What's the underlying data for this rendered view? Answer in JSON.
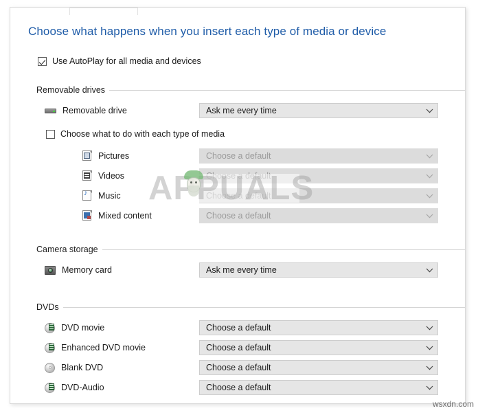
{
  "window": {
    "page_title": "Choose what happens when you insert each type of media or device"
  },
  "autoplay_toggle": {
    "label": "Use AutoPlay for all media and devices",
    "checked": true
  },
  "each_type_toggle": {
    "label": "Choose what to do with each type of media",
    "checked": false
  },
  "sections": {
    "removable_drives": {
      "label": "Removable drives",
      "rows": [
        {
          "icon": "removable-drive-icon",
          "label": "Removable drive",
          "value": "Ask me every time",
          "enabled": true
        }
      ],
      "media_types": [
        {
          "icon": "pictures-icon",
          "label": "Pictures",
          "value": "Choose a default",
          "enabled": false
        },
        {
          "icon": "videos-icon",
          "label": "Videos",
          "value": "Choose a default",
          "enabled": false
        },
        {
          "icon": "music-icon",
          "label": "Music",
          "value": "Choose a default",
          "enabled": false
        },
        {
          "icon": "mixed-content-icon",
          "label": "Mixed content",
          "value": "Choose a default",
          "enabled": false
        }
      ]
    },
    "camera_storage": {
      "label": "Camera storage",
      "rows": [
        {
          "icon": "memory-card-icon",
          "label": "Memory card",
          "value": "Ask me every time",
          "enabled": true
        }
      ]
    },
    "dvds": {
      "label": "DVDs",
      "rows": [
        {
          "icon": "dvd-movie-icon",
          "label": "DVD movie",
          "value": "Choose a default",
          "enabled": true
        },
        {
          "icon": "enhanced-dvd-movie-icon",
          "label": "Enhanced DVD movie",
          "value": "Choose a default",
          "enabled": true
        },
        {
          "icon": "blank-dvd-icon",
          "label": "Blank DVD",
          "value": "Choose a default",
          "enabled": true
        },
        {
          "icon": "dvd-audio-icon",
          "label": "DVD-Audio",
          "value": "Choose a default",
          "enabled": true
        }
      ]
    }
  },
  "watermarks": {
    "brand": "APPUALS",
    "bottom_right": "wsxdn.com"
  },
  "colors": {
    "heading": "#1f5ca8",
    "text": "#1b1b1b",
    "disabled_text": "#9b9b9b",
    "combo_enabled_bg": "#e6e6e6",
    "combo_disabled_bg": "#dcdcdc",
    "rule": "#d5d5d5"
  }
}
